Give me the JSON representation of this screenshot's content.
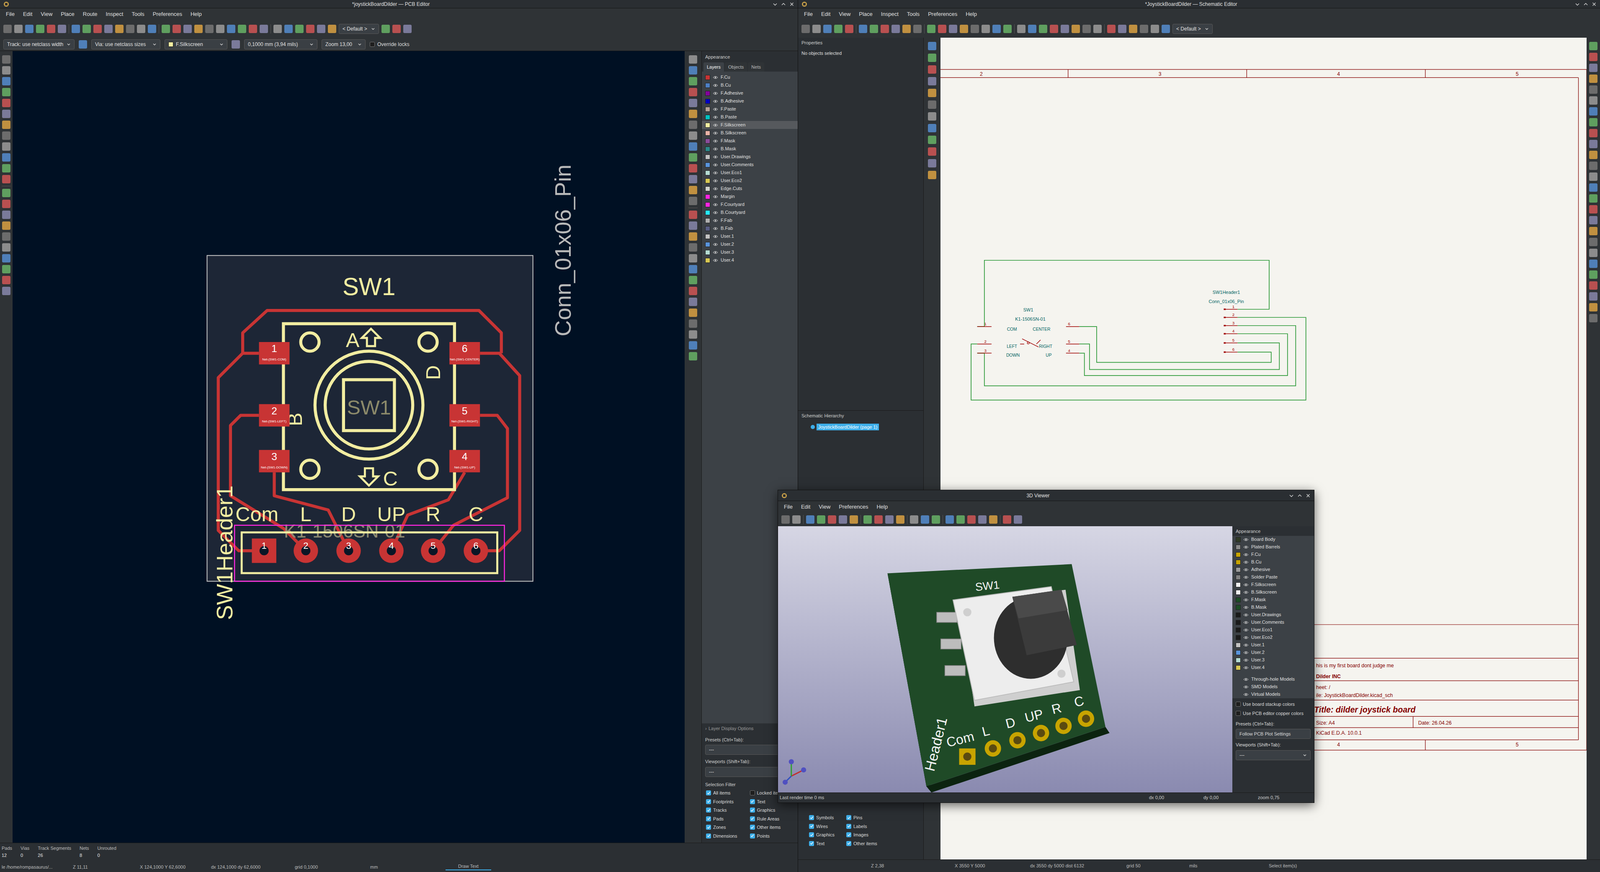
{
  "pcb_editor": {
    "title": "*joystickBoardDilder — PCB Editor",
    "menu": [
      "File",
      "Edit",
      "View",
      "Place",
      "Route",
      "Inspect",
      "Tools",
      "Preferences",
      "Help"
    ],
    "preset": "< Default >",
    "options": {
      "track": "Track: use netclass width",
      "via": "Via: use netclass sizes",
      "layer": {
        "name": "F.Silkscreen",
        "color": "#f2eda1"
      },
      "grid": "0,1000 mm (3,94 mils)",
      "zoom": "Zoom 13,00",
      "override_locks": {
        "label": "Override locks",
        "checked": false
      }
    },
    "canvas": {
      "footprint_ref": "SW1",
      "footprint_value": "K1-1506SN-01",
      "body_label": "SW1",
      "direction_labels": {
        "top": "A",
        "left": "B",
        "bottom": "C",
        "right": "D"
      },
      "pads": [
        {
          "number": "1",
          "net": "Net-(SW1-COM)"
        },
        {
          "number": "2",
          "net": "Net-(SW1-LEFT)"
        },
        {
          "number": "3",
          "net": "Net-(SW1-DOWN)"
        },
        {
          "number": "4",
          "net": "Net-(SW1-UP)"
        },
        {
          "number": "5",
          "net": "Net-(SW1-RIGHT)"
        },
        {
          "number": "6",
          "net": "Net-(SW1-CENTER)"
        }
      ],
      "header_ref": "SW1Header1",
      "header_value": "Conn_01x06_Pin",
      "header_pins": [
        {
          "number": "1",
          "label": "Com"
        },
        {
          "number": "2",
          "label": "L"
        },
        {
          "number": "3",
          "label": "D"
        },
        {
          "number": "4",
          "label": "UP"
        },
        {
          "number": "5",
          "label": "R"
        },
        {
          "number": "6",
          "label": "C"
        }
      ]
    },
    "appearance": {
      "title": "Appearance",
      "tabs": [
        {
          "label": "Layers",
          "selected": true
        },
        {
          "label": "Objects",
          "selected": false
        },
        {
          "label": "Nets",
          "selected": false
        }
      ],
      "layers": [
        {
          "name": "F.Cu",
          "color": "#c83434",
          "visible": true,
          "selected": false
        },
        {
          "name": "B.Cu",
          "color": "#4d7fc4",
          "visible": true,
          "selected": false
        },
        {
          "name": "F.Adhesive",
          "color": "#84009c",
          "visible": true,
          "selected": false
        },
        {
          "name": "B.Adhesive",
          "color": "#0000c2",
          "visible": true,
          "selected": false
        },
        {
          "name": "F.Paste",
          "color": "#b4a096",
          "visible": true,
          "selected": false
        },
        {
          "name": "B.Paste",
          "color": "#00c2c2",
          "visible": true,
          "selected": false
        },
        {
          "name": "F.Silkscreen",
          "color": "#f2eda1",
          "visible": true,
          "selected": true
        },
        {
          "name": "B.Silkscreen",
          "color": "#e8b2a7",
          "visible": true,
          "selected": false
        },
        {
          "name": "F.Mask",
          "color": "#8a4c9a",
          "visible": true,
          "selected": false
        },
        {
          "name": "B.Mask",
          "color": "#2a8a8a",
          "visible": true,
          "selected": false
        },
        {
          "name": "User.Drawings",
          "color": "#c2c2c2",
          "visible": true,
          "selected": false
        },
        {
          "name": "User.Comments",
          "color": "#5994dc",
          "visible": true,
          "selected": false
        },
        {
          "name": "User.Eco1",
          "color": "#b4dbd2",
          "visible": true,
          "selected": false
        },
        {
          "name": "User.Eco2",
          "color": "#d8c852",
          "visible": true,
          "selected": false
        },
        {
          "name": "Edge.Cuts",
          "color": "#d0d2cd",
          "visible": true,
          "selected": false
        },
        {
          "name": "Margin",
          "color": "#ff26e2",
          "visible": true,
          "selected": false
        },
        {
          "name": "F.Courtyard",
          "color": "#ff26e2",
          "visible": true,
          "selected": false
        },
        {
          "name": "B.Courtyard",
          "color": "#26e9ff",
          "visible": true,
          "selected": false
        },
        {
          "name": "F.Fab",
          "color": "#afafaf",
          "visible": true,
          "selected": false
        },
        {
          "name": "B.Fab",
          "color": "#585d84",
          "visible": true,
          "selected": false
        },
        {
          "name": "User.1",
          "color": "#c2c2c2",
          "visible": true,
          "selected": false
        },
        {
          "name": "User.2",
          "color": "#5994dc",
          "visible": true,
          "selected": false
        },
        {
          "name": "User.3",
          "color": "#b4dbd2",
          "visible": true,
          "selected": false
        },
        {
          "name": "User.4",
          "color": "#d8c852",
          "visible": true,
          "selected": false
        }
      ],
      "display_options": "Layer Display Options",
      "presets_label": "Presets (Ctrl+Tab):",
      "presets_value": "---",
      "viewports_label": "Viewports (Shift+Tab):",
      "viewports_value": "---"
    },
    "selection_filter": {
      "title": "Selection Filter",
      "items": [
        {
          "label": "All items",
          "checked": true
        },
        {
          "label": "Locked items",
          "checked": false
        },
        {
          "label": "Footprints",
          "checked": true
        },
        {
          "label": "Text",
          "checked": true
        },
        {
          "label": "Tracks",
          "checked": true
        },
        {
          "label": "Graphics",
          "checked": true
        },
        {
          "label": "Pads",
          "checked": true
        },
        {
          "label": "Rule Areas",
          "checked": true
        },
        {
          "label": "Zones",
          "checked": true
        },
        {
          "label": "Other items",
          "checked": true
        },
        {
          "label": "Dimensions",
          "checked": true
        },
        {
          "label": "Points",
          "checked": true
        }
      ]
    },
    "stats": [
      {
        "label": "Pads",
        "value": "12"
      },
      {
        "label": "Vias",
        "value": "0"
      },
      {
        "label": "Track Segments",
        "value": "26"
      },
      {
        "label": "Nets",
        "value": "8"
      },
      {
        "label": "Unrouted",
        "value": "0"
      }
    ],
    "status": {
      "file": "le /home/rompasaurus/...",
      "z": "Z 11,11",
      "xy": "X 124,1000 Y 62,6000",
      "dxy": "dx 124,1000 dy 62,6000",
      "grid": "grid 0,1000",
      "units": "mm",
      "tool": "Draw Text"
    }
  },
  "schematic_editor": {
    "title": "*JoystickBoardDilder — Schematic Editor",
    "menu": [
      "File",
      "Edit",
      "View",
      "Place",
      "Inspect",
      "Tools",
      "Preferences",
      "Help"
    ],
    "preset": "< Default >",
    "properties": {
      "title": "Properties",
      "empty": "No objects selected"
    },
    "hierarchy": {
      "title": "Schematic Hierarchy",
      "items": [
        {
          "label": "JoystickBoardDilder (page 1)",
          "selected": true
        }
      ]
    },
    "selection_filter": [
      {
        "label": "Symbols",
        "checked": true
      },
      {
        "label": "Pins",
        "checked": true
      },
      {
        "label": "Wires",
        "checked": true
      },
      {
        "label": "Labels",
        "checked": true
      },
      {
        "label": "Graphics",
        "checked": true
      },
      {
        "label": "Images",
        "checked": true
      },
      {
        "label": "Text",
        "checked": true
      },
      {
        "label": "Other items",
        "checked": true
      }
    ],
    "canvas": {
      "columns_top": [
        "2",
        "3",
        "4",
        "5"
      ],
      "columns_bottom": [
        "4",
        "5"
      ],
      "symbol": {
        "ref": "SW1",
        "value": "K1-1506SN-01",
        "pins": [
          {
            "number": "1",
            "name": "COM",
            "side": "left"
          },
          {
            "number": "2",
            "name": "LEFT",
            "side": "left"
          },
          {
            "number": "3",
            "name": "DOWN",
            "side": "left"
          },
          {
            "number": "6",
            "name": "CENTER",
            "side": "right"
          },
          {
            "number": "5",
            "name": "RIGHT",
            "side": "right"
          },
          {
            "number": "4",
            "name": "UP",
            "side": "right"
          }
        ]
      },
      "header": {
        "ref": "SW1Header1",
        "value": "Conn_01x06_Pin",
        "pins": [
          "1",
          "2",
          "3",
          "4",
          "5",
          "6"
        ]
      },
      "title_block": {
        "comment": "his is my first board dont judge me",
        "company": "Dilder INC",
        "sheet": "heet: /",
        "file": "ile: JoystickBoardDilder.kicad_sch",
        "title": "Title: dilder joystick board",
        "size": "Size: A4",
        "date": "Date: 26.04.26",
        "tool": "KiCad E.D.A. 10.0.1"
      }
    },
    "status": {
      "z": "Z 2,38",
      "xy": "X 3550 Y 5000",
      "dxy": "dx 3550 dy 5000 dist 6132",
      "grid": "grid 50",
      "units": "mils",
      "tool": "Select item(s)"
    }
  },
  "viewer_3d": {
    "title": "3D Viewer",
    "menu": [
      "File",
      "Edit",
      "View",
      "Preferences",
      "Help"
    ],
    "scene": {
      "silk_ref": "SW1",
      "silk_labels": [
        "Com",
        "L",
        "D",
        "UP",
        "R",
        "C"
      ],
      "silk_header": "Header1"
    },
    "appearance": {
      "title": "Appearance",
      "layers": [
        {
          "name": "Board Body",
          "color": "#2f3a26",
          "visible": true
        },
        {
          "name": "Plated Barrels",
          "color": "#8a8a8a",
          "visible": true
        },
        {
          "name": "F.Cu",
          "color": "#c8a400",
          "visible": true
        },
        {
          "name": "B.Cu",
          "color": "#c8a400",
          "visible": true
        },
        {
          "name": "Adhesive",
          "color": "#9a9a9a",
          "visible": true
        },
        {
          "name": "Solder Paste",
          "color": "#808080",
          "visible": true
        },
        {
          "name": "F.Silkscreen",
          "color": "#f0f0f0",
          "visible": true
        },
        {
          "name": "B.Silkscreen",
          "color": "#f0f0f0",
          "visible": true
        },
        {
          "name": "F.Mask",
          "color": "#1c4d24",
          "visible": true
        },
        {
          "name": "B.Mask",
          "color": "#1c4d24",
          "visible": true
        },
        {
          "name": "User.Drawings",
          "color": "#1a1a1a",
          "visible": true
        },
        {
          "name": "User.Comments",
          "color": "#1a1a1a",
          "visible": true
        },
        {
          "name": "User.Eco1",
          "color": "#1a1a1a",
          "visible": true
        },
        {
          "name": "User.Eco2",
          "color": "#1a1a1a",
          "visible": true
        },
        {
          "name": "User.1",
          "color": "#c2c2c2",
          "visible": true
        },
        {
          "name": "User.2",
          "color": "#5994dc",
          "visible": true
        },
        {
          "name": "User.3",
          "color": "#b4dbd2",
          "visible": true
        },
        {
          "name": "User.4",
          "color": "#d8c852",
          "visible": true
        }
      ],
      "models": [
        {
          "label": "Through-hole Models",
          "visible": true
        },
        {
          "label": "SMD Models",
          "visible": true
        },
        {
          "label": "Virtual Models",
          "visible": true
        }
      ],
      "options": [
        {
          "label": "Use board stackup colors",
          "checked": false
        },
        {
          "label": "Use PCB editor copper colors",
          "checked": false
        }
      ],
      "presets_label": "Presets (Ctrl+Tab):",
      "presets_button": "Follow PCB Plot Settings",
      "viewports_label": "Viewports (Shift+Tab):",
      "viewports_value": "---"
    },
    "status": {
      "render": "Last render time 0 ms",
      "dx": "dx 0,00",
      "dy": "dy 0,00",
      "zoom": "zoom 0,75"
    }
  }
}
